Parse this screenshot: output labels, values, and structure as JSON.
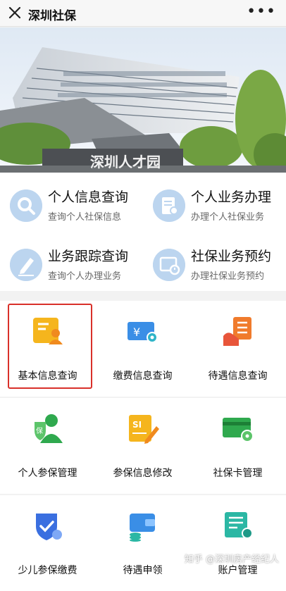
{
  "header": {
    "title": "深圳社保",
    "more_label": "•••"
  },
  "banner": {
    "sign_text": "深圳人才园"
  },
  "quick_services": [
    {
      "title": "个人信息查询",
      "subtitle": "查询个人社保信息",
      "icon": "search-icon"
    },
    {
      "title": "个人业务办理",
      "subtitle": "办理个人社保业务",
      "icon": "edit-document-icon"
    },
    {
      "title": "业务跟踪查询",
      "subtitle": "查询个人办理业务",
      "icon": "pencil-icon"
    },
    {
      "title": "社保业务预约",
      "subtitle": "办理社保业务预约",
      "icon": "calendar-clock-icon"
    }
  ],
  "grid": [
    {
      "label": "基本信息查询",
      "icon": "id-card-icon",
      "highlighted": true
    },
    {
      "label": "缴费信息查询",
      "icon": "payment-ticket-icon"
    },
    {
      "label": "待遇信息查询",
      "icon": "hand-checklist-icon"
    },
    {
      "label": "个人参保管理",
      "icon": "insured-person-icon"
    },
    {
      "label": "参保信息修改",
      "icon": "si-edit-icon"
    },
    {
      "label": "社保卡管理",
      "icon": "card-gear-icon"
    },
    {
      "label": "少儿参保缴费",
      "icon": "child-shield-icon"
    },
    {
      "label": "待遇申领",
      "icon": "wallet-coins-icon"
    },
    {
      "label": "账户管理",
      "icon": "account-gear-icon"
    }
  ],
  "watermark": "知乎 @深圳房产经纪人",
  "colors": {
    "highlight": "#d9302a",
    "yellow": "#f5b51d",
    "blue": "#3a8ee6",
    "green": "#2fa94e",
    "orange": "#f07b2c",
    "teal": "#2bb7a4"
  }
}
